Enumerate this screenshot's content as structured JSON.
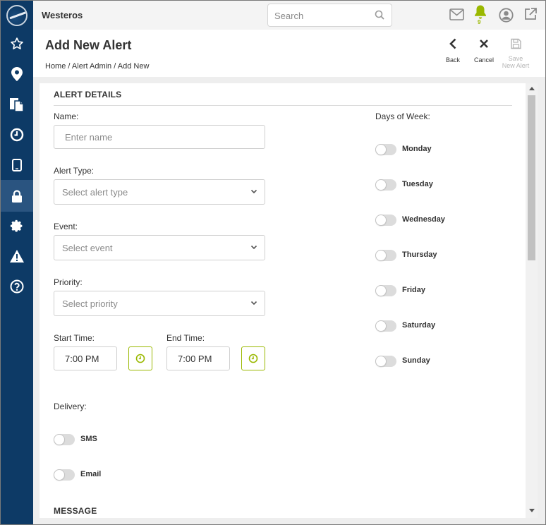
{
  "app": {
    "brand": "Westeros"
  },
  "search": {
    "placeholder": "Search"
  },
  "notifications": {
    "count": "9"
  },
  "header": {
    "title": "Add New Alert",
    "breadcrumb": [
      "Home",
      "Alert Admin",
      "Add New"
    ],
    "breadcrumb_sep": "/",
    "actions": {
      "back": "Back",
      "cancel": "Cancel",
      "save": "Save New Alert"
    }
  },
  "form": {
    "section_title": "ALERT DETAILS",
    "name_label": "Name:",
    "name_placeholder": "Enter name",
    "alert_type_label": "Alert Type:",
    "alert_type_placeholder": "Select alert type",
    "event_label": "Event:",
    "event_placeholder": "Select event",
    "priority_label": "Priority:",
    "priority_placeholder": "Select priority",
    "start_time_label": "Start Time:",
    "start_time_value": "7:00 PM",
    "end_time_label": "End Time:",
    "end_time_value": "7:00 PM",
    "delivery_label": "Delivery:",
    "delivery": [
      {
        "label": "SMS",
        "on": false
      },
      {
        "label": "Email",
        "on": false
      }
    ],
    "days_label": "Days of Week:",
    "days": [
      {
        "label": "Monday",
        "on": false
      },
      {
        "label": "Tuesday",
        "on": false
      },
      {
        "label": "Wednesday",
        "on": false
      },
      {
        "label": "Thursday",
        "on": false
      },
      {
        "label": "Friday",
        "on": false
      },
      {
        "label": "Saturday",
        "on": false
      },
      {
        "label": "Sunday",
        "on": false
      }
    ],
    "message_title": "MESSAGE"
  },
  "colors": {
    "sidebar": "#0d3a66",
    "sidebar_active": "#2a5480",
    "accent": "#9ab800"
  },
  "icons": {
    "sidebar": [
      "star-icon",
      "location-pin-icon",
      "documents-icon",
      "clock-icon",
      "tablet-icon",
      "lock-icon",
      "gear-icon",
      "warning-icon",
      "help-icon"
    ],
    "topbar": [
      "mail-icon",
      "bell-icon",
      "user-icon",
      "external-link-icon"
    ]
  }
}
